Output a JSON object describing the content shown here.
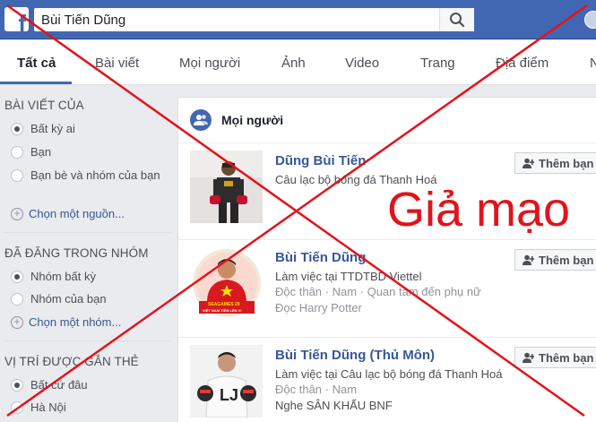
{
  "header": {
    "logo_letter": "f",
    "search_value": "Bùi Tiến Dũng"
  },
  "tabs": [
    {
      "label": "Tất cả",
      "active": true
    },
    {
      "label": "Bài viết"
    },
    {
      "label": "Mọi người"
    },
    {
      "label": "Ảnh"
    },
    {
      "label": "Video"
    },
    {
      "label": "Trang"
    },
    {
      "label": "Địa điểm"
    },
    {
      "label": "N"
    }
  ],
  "sidebar": {
    "sections": [
      {
        "heading": "BÀI VIẾT CỦA",
        "options": [
          "Bất kỳ ai",
          "Bạn",
          "Bạn bè và nhóm của bạn"
        ],
        "selected": 0,
        "more_link": "Chọn một nguồn..."
      },
      {
        "heading": "ĐÃ ĐĂNG TRONG NHÓM",
        "options": [
          "Nhóm bất kỳ",
          "Nhóm của bạn"
        ],
        "selected": 0,
        "more_link": "Chọn một nhóm..."
      },
      {
        "heading": "VỊ TRÍ ĐƯỢC GẮN THẺ",
        "options": [
          "Bất cứ đâu",
          "Hà Nội"
        ],
        "selected": 0
      }
    ]
  },
  "results": {
    "title": "Mọi người",
    "add_friend_label": "Thêm bạn",
    "people": [
      {
        "name": "Dũng Bùi Tiến",
        "lines": [
          "Câu lạc bộ bóng đá Thanh Hoá"
        ]
      },
      {
        "name": "Bùi Tiến Dũng",
        "lines": [
          "Làm việc tại TTDTBD Viettel",
          "Độc thân · Nam · Quan tâm đến phụ nữ",
          "Đọc Harry Potter"
        ],
        "badge_text": "SEAGAMES 29",
        "badge_sub": "VIỆT NAM TIẾN LÊN !!!"
      },
      {
        "name": "Bùi Tiến Dũng (Thủ Môn)",
        "lines": [
          "Làm việc tại Câu lạc bộ bóng đá Thanh Hoá",
          "Độc thân · Nam",
          "Nghe SÂN KHẤU BNF"
        ]
      }
    ]
  },
  "overlay": {
    "stamp_text": "Giả mạo",
    "color": "#e2131b"
  },
  "colors": {
    "brand": "#4267b2",
    "link": "#365899",
    "page_bg": "#e9ebee"
  }
}
